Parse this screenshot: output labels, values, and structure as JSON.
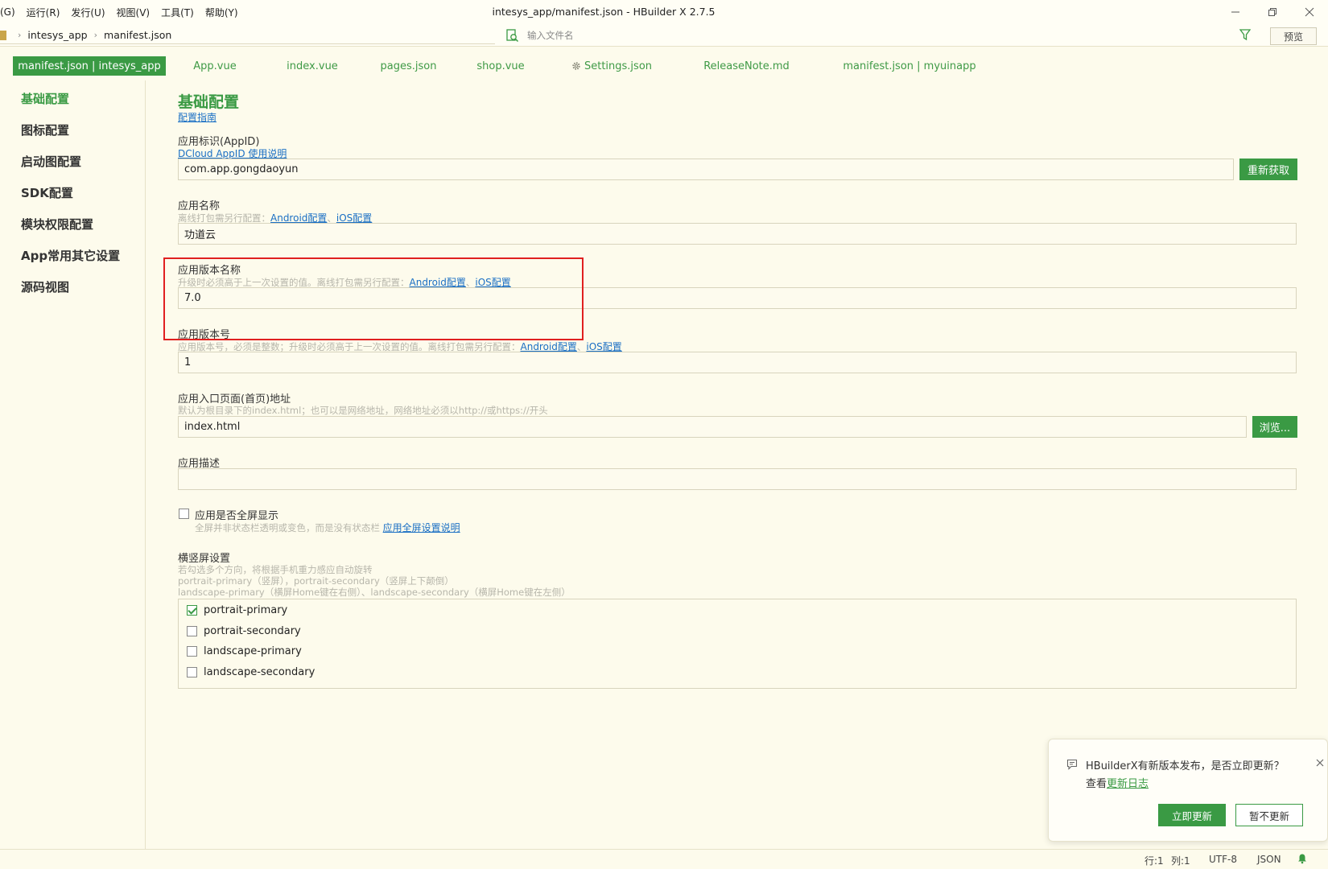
{
  "menu": {
    "items": [
      "(G)",
      "运行(R)",
      "发行(U)",
      "视图(V)",
      "工具(T)",
      "帮助(Y)"
    ],
    "window_title": "intesys_app/manifest.json - HBuilder X 2.7.5"
  },
  "toolbar": {
    "breadcrumb": [
      "intesys_app",
      "manifest.json"
    ],
    "search_placeholder": "输入文件名",
    "preview_label": "预览"
  },
  "tabs": [
    {
      "label": "manifest.json | intesys_app",
      "active": true
    },
    {
      "label": "App.vue"
    },
    {
      "label": "index.vue"
    },
    {
      "label": "pages.json"
    },
    {
      "label": "shop.vue"
    },
    {
      "label": "Settings.json"
    },
    {
      "label": "ReleaseNote.md"
    },
    {
      "label": "manifest.json | myuinapp"
    }
  ],
  "sidebar": {
    "items": [
      "基础配置",
      "图标配置",
      "启动图配置",
      "SDK配置",
      "模块权限配置",
      "App常用其它设置",
      "源码视图"
    ],
    "active_index": 0
  },
  "main": {
    "title": "基础配置",
    "guide_link": "配置指南",
    "appid": {
      "label": "应用标识(AppID)",
      "help_link": "DCloud AppID 使用说明",
      "value": "com.app.gongdaoyun",
      "button": "重新获取"
    },
    "app_name": {
      "label": "应用名称",
      "hint": "离线打包需另行配置：",
      "android_link": "Android配置",
      "sep": "、",
      "ios_link": "iOS配置",
      "value": "功道云"
    },
    "version_name": {
      "label": "应用版本名称",
      "hint": "升级时必须高于上一次设置的值。离线打包需另行配置：",
      "android_link": "Android配置",
      "sep": "、",
      "ios_link": "iOS配置",
      "value": "7.0"
    },
    "version_code": {
      "label": "应用版本号",
      "hint": "应用版本号，必须是整数；升级时必须高于上一次设置的值。离线打包需另行配置：",
      "android_link": "Android配置",
      "sep": "、",
      "ios_link": "iOS配置",
      "value": "1"
    },
    "entry": {
      "label": "应用入口页面(首页)地址",
      "hint": "默认为根目录下的index.html；也可以是网络地址，网络地址必须以http://或https://开头",
      "value": "index.html",
      "button": "浏览..."
    },
    "description": {
      "label": "应用描述",
      "value": ""
    },
    "fullscreen": {
      "label": "应用是否全屏显示",
      "checked": false,
      "hint": "全屏并非状态栏透明或变色，而是没有状态栏",
      "link": "应用全屏设置说明"
    },
    "orientation": {
      "label": "横竖屏设置",
      "hint1": "若勾选多个方向，将根据手机重力感应自动旋转",
      "hint2": "portrait-primary（竖屏），portrait-secondary（竖屏上下颠倒）",
      "hint3": "landscape-primary（横屏Home键在右侧）、landscape-secondary（横屏Home键在左侧）",
      "options": [
        {
          "label": "portrait-primary",
          "checked": true
        },
        {
          "label": "portrait-secondary",
          "checked": false
        },
        {
          "label": "landscape-primary",
          "checked": false
        },
        {
          "label": "landscape-secondary",
          "checked": false
        }
      ]
    }
  },
  "notification": {
    "message": "HBuilderX有新版本发布，是否立即更新？",
    "view_prefix": "查看",
    "changelog_link": "更新日志",
    "update_now": "立即更新",
    "not_now": "暂不更新"
  },
  "status_bar": {
    "line": "行:1",
    "col": "列:1",
    "encoding": "UTF-8",
    "language": "JSON"
  },
  "colors": {
    "accent": "#3a9a44",
    "background": "#fdfbec",
    "link": "#1a6fc4",
    "highlight_box": "#e02020"
  }
}
